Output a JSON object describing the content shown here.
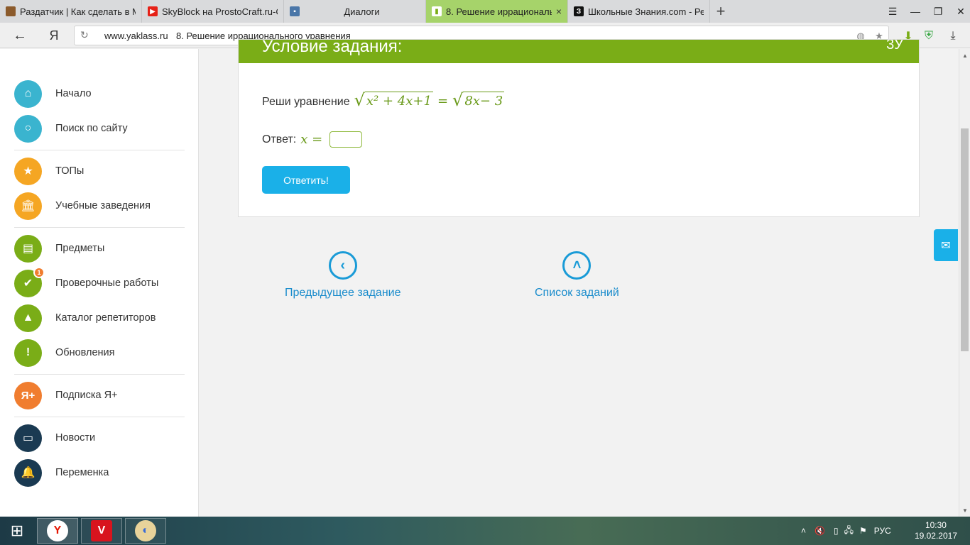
{
  "tabs": [
    {
      "label": "Раздатчик | Как сделать в М",
      "icon": "book-stack-icon",
      "color": "#8b5a2b",
      "active": false
    },
    {
      "label": "SkyBlock на ProstoCraft.ru-С",
      "icon": "youtube-icon",
      "color": "#e62117",
      "active": false
    },
    {
      "label": "Диалоги",
      "icon": "chat-icon",
      "color": "#4a76a8",
      "active": false
    },
    {
      "label": "8. Решение иррациональ",
      "icon": "open-book-icon",
      "color": "#7aad17",
      "active": true
    },
    {
      "label": "Школьные Знания.com - Ре",
      "icon": "znanija-icon",
      "color": "#111111",
      "active": false
    }
  ],
  "tab_close_glyph": "×",
  "new_tab_glyph": "+",
  "address": {
    "domain": "www.yaklass.ru",
    "page_title": "8. Решение иррационального уравнения"
  },
  "sidebar": {
    "items": [
      {
        "label": "Начало",
        "icon": "home-icon",
        "color": "#3ab4cf"
      },
      {
        "label": "Поиск по сайту",
        "icon": "search-icon",
        "color": "#3ab4cf"
      },
      {
        "label": "ТОПы",
        "icon": "star-icon",
        "color": "#f5a623"
      },
      {
        "label": "Учебные заведения",
        "icon": "building-icon",
        "color": "#f5a623"
      },
      {
        "label": "Предметы",
        "icon": "book-icon",
        "color": "#7aad17"
      },
      {
        "label": "Проверочные работы",
        "icon": "check-icon",
        "color": "#7aad17",
        "badge": "1"
      },
      {
        "label": "Каталог репетиторов",
        "icon": "graduation-cap-icon",
        "color": "#7aad17"
      },
      {
        "label": "Обновления",
        "icon": "exclamation-icon",
        "color": "#7aad17"
      },
      {
        "label": "Подписка Я+",
        "icon": "yaplus-icon",
        "color": "#f07d2f"
      },
      {
        "label": "Новости",
        "icon": "speech-bubble-icon",
        "color": "#1a3a52"
      },
      {
        "label": "Переменка",
        "icon": "bell-icon",
        "color": "#1a3a52"
      }
    ]
  },
  "card": {
    "header_title": "Условие задания:",
    "header_right": "3У",
    "task_prefix": "Реши уравнение",
    "lhs_radicand": "x² + 4x+1",
    "equals": "=",
    "rhs_radicand": "8x− 3",
    "answer_label": "Ответ:",
    "answer_var": "x =",
    "answer_value": "",
    "submit_label": "Ответить!"
  },
  "nav": {
    "prev_label": "Предыдущее задание",
    "list_label": "Список заданий"
  },
  "taskbar": {
    "lang": "РУС",
    "time": "10:30",
    "date": "19.02.2017"
  }
}
